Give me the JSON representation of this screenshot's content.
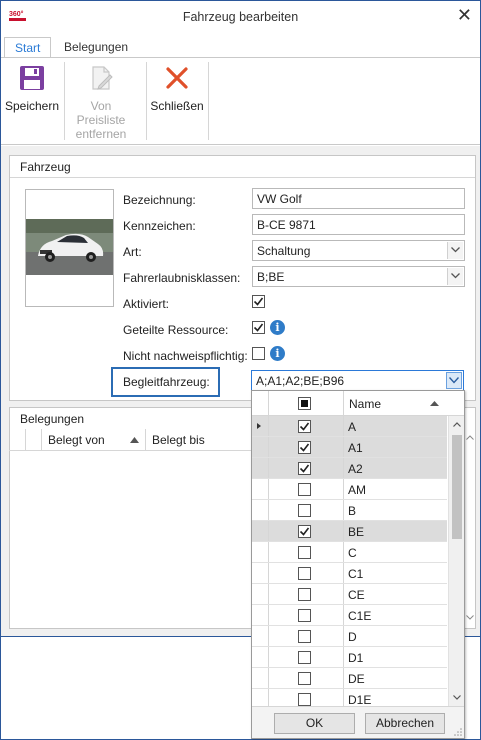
{
  "window": {
    "title": "Fahrzeug bearbeiten",
    "logo_text": "360°"
  },
  "tabs": [
    {
      "label": "Start"
    },
    {
      "label": "Belegungen"
    }
  ],
  "ribbon": {
    "save_label": "Speichern",
    "remove_label_line1": "Von Preisliste",
    "remove_label_line2": "entfernen",
    "close_label": "Schließen"
  },
  "fahrzeug": {
    "group_title": "Fahrzeug",
    "bezeichnung_label": "Bezeichnung:",
    "bezeichnung_value": "VW Golf",
    "kennzeichen_label": "Kennzeichen:",
    "kennzeichen_value": "B-CE 9871",
    "art_label": "Art:",
    "art_value": "Schaltung",
    "fahrerlaubnis_label": "Fahrerlaubnisklassen:",
    "fahrerlaubnis_value": "B;BE",
    "aktiviert_label": "Aktiviert:",
    "aktiviert_checked": true,
    "geteilte_label": "Geteilte Ressource:",
    "geteilte_checked": true,
    "nicht_nachweis_label": "Nicht nachweispflichtig:",
    "nicht_nachweis_checked": false,
    "begleit_label": "Begleitfahrzeug:",
    "begleit_value": "A;A1;A2;BE;B96"
  },
  "belegungen": {
    "group_title": "Belegungen",
    "columns": [
      "Belegt von",
      "Belegt bis"
    ]
  },
  "popup": {
    "name_header": "Name",
    "rows": [
      {
        "name": "A",
        "checked": true,
        "selected": true
      },
      {
        "name": "A1",
        "checked": true,
        "selected": true
      },
      {
        "name": "A2",
        "checked": true,
        "selected": true
      },
      {
        "name": "AM",
        "checked": false,
        "selected": false
      },
      {
        "name": "B",
        "checked": false,
        "selected": false
      },
      {
        "name": "BE",
        "checked": true,
        "selected": true
      },
      {
        "name": "C",
        "checked": false,
        "selected": false
      },
      {
        "name": "C1",
        "checked": false,
        "selected": false
      },
      {
        "name": "CE",
        "checked": false,
        "selected": false
      },
      {
        "name": "C1E",
        "checked": false,
        "selected": false
      },
      {
        "name": "D",
        "checked": false,
        "selected": false
      },
      {
        "name": "D1",
        "checked": false,
        "selected": false
      },
      {
        "name": "DE",
        "checked": false,
        "selected": false
      },
      {
        "name": "D1E",
        "checked": false,
        "selected": false
      }
    ],
    "ok_label": "OK",
    "cancel_label": "Abbrechen"
  },
  "colors": {
    "accent": "#2b7bd6",
    "save_icon": "#7b3fa0",
    "close_icon": "#e0502a",
    "info": "#2f7cc8"
  }
}
